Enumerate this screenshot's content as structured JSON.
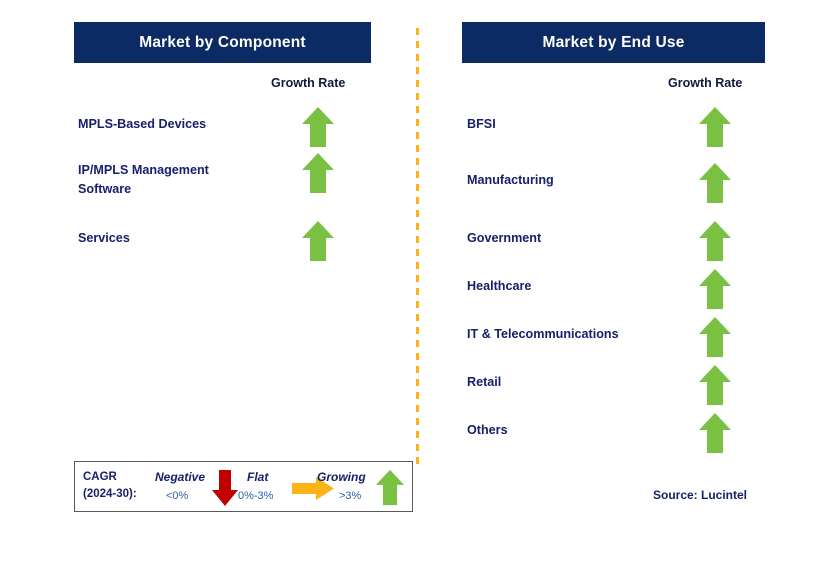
{
  "colors": {
    "header_bg": "#0c2a63",
    "header_text": "#ffffff",
    "label_navy": "#16216b",
    "arrow_green": "#7ac143",
    "arrow_red": "#c00000",
    "arrow_orange": "#fcb316",
    "divider_orange": "#fcb316",
    "legend_border": "#595959",
    "legend_range_blue": "#2e5fa3"
  },
  "panels": [
    {
      "title": "Market by Component",
      "growth_rate_label": "Growth Rate",
      "rows": [
        {
          "label": "MPLS-Based Devices",
          "trend": "growing",
          "icon": "arrow-up-icon"
        },
        {
          "label": "IP/MPLS Management\nSoftware",
          "trend": "growing",
          "icon": "arrow-up-icon"
        },
        {
          "label": "Services",
          "trend": "growing",
          "icon": "arrow-up-icon"
        }
      ]
    },
    {
      "title": "Market by End Use",
      "growth_rate_label": "Growth Rate",
      "rows": [
        {
          "label": "BFSI",
          "trend": "growing",
          "icon": "arrow-up-icon"
        },
        {
          "label": "Manufacturing",
          "trend": "growing",
          "icon": "arrow-up-icon"
        },
        {
          "label": "Government",
          "trend": "growing",
          "icon": "arrow-up-icon"
        },
        {
          "label": "Healthcare",
          "trend": "growing",
          "icon": "arrow-up-icon"
        },
        {
          "label": "IT & Telecommunications",
          "trend": "growing",
          "icon": "arrow-up-icon"
        },
        {
          "label": "Retail",
          "trend": "growing",
          "icon": "arrow-up-icon"
        },
        {
          "label": "Others",
          "trend": "growing",
          "icon": "arrow-up-icon"
        }
      ]
    }
  ],
  "legend": {
    "title": "CAGR\n(2024-30):",
    "items": [
      {
        "word": "Negative",
        "range": "<0%",
        "icon": "arrow-down-icon"
      },
      {
        "word": "Flat",
        "range": "0%-3%",
        "icon": "arrow-right-icon"
      },
      {
        "word": "Growing",
        "range": ">3%",
        "icon": "arrow-up-icon"
      }
    ]
  },
  "source": "Source: Lucintel",
  "chart_data": {
    "type": "table",
    "title": "MPLS Market Segment Growth Outlook",
    "legend_scale": {
      "metric": "CAGR (2024-30)",
      "bands": [
        {
          "name": "Negative",
          "range": "<0%",
          "color": "#c00000"
        },
        {
          "name": "Flat",
          "range": "0%-3%",
          "color": "#fcb316"
        },
        {
          "name": "Growing",
          "range": ">3%",
          "color": "#7ac143"
        }
      ]
    },
    "groups": [
      {
        "name": "Market by Component",
        "value_header": "Growth Rate",
        "categories": [
          "MPLS-Based Devices",
          "IP/MPLS Management Software",
          "Services"
        ],
        "values": [
          "Growing",
          "Growing",
          "Growing"
        ]
      },
      {
        "name": "Market by End Use",
        "value_header": "Growth Rate",
        "categories": [
          "BFSI",
          "Manufacturing",
          "Government",
          "Healthcare",
          "IT & Telecommunications",
          "Retail",
          "Others"
        ],
        "values": [
          "Growing",
          "Growing",
          "Growing",
          "Growing",
          "Growing",
          "Growing",
          "Growing"
        ]
      }
    ],
    "source": "Source: Lucintel"
  }
}
